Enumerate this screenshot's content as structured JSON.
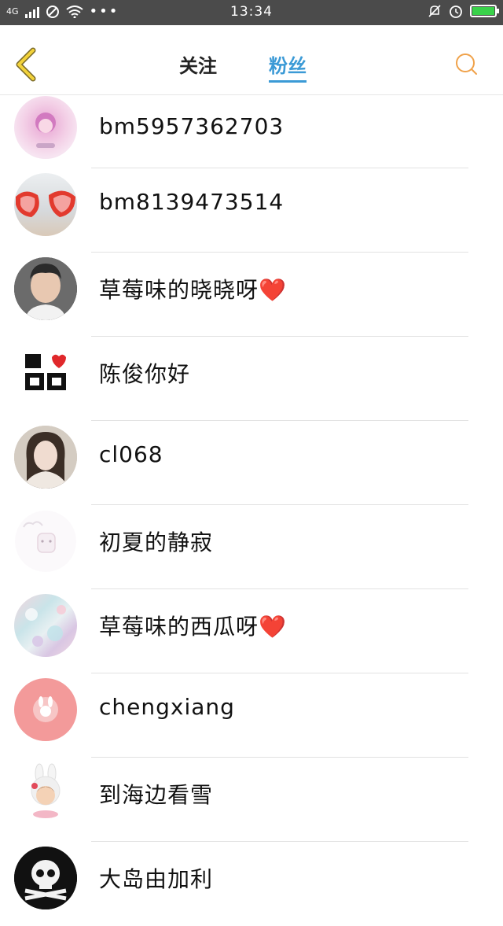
{
  "status_bar": {
    "network": "4G",
    "time": "13:34"
  },
  "header": {
    "tabs": [
      {
        "label": "关注"
      },
      {
        "label": "粉丝"
      }
    ],
    "active_tab": "粉丝",
    "accent_color": "#3b9ad6",
    "search_icon_color": "#f0a24a"
  },
  "fans": [
    {
      "name": "bm5957362703"
    },
    {
      "name": "bm8139473514"
    },
    {
      "name": "草莓味的晓晓呀❤️"
    },
    {
      "name": "陈俊你好"
    },
    {
      "name": "cl068"
    },
    {
      "name": "初夏的静寂"
    },
    {
      "name": "草莓味的西瓜呀❤️"
    },
    {
      "name": "chengxiang"
    },
    {
      "name": "到海边看雪"
    },
    {
      "name": "大岛由加利"
    }
  ]
}
